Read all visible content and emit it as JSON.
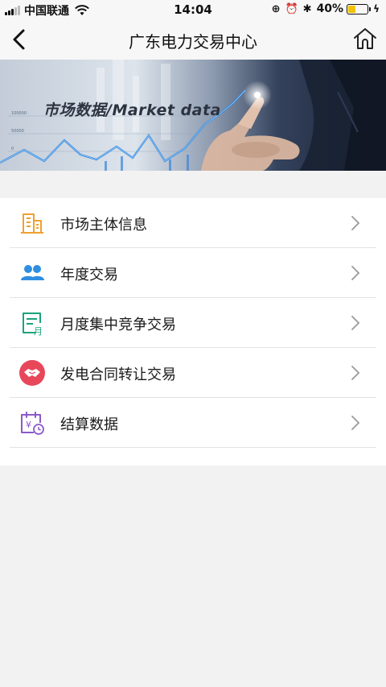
{
  "status_bar": {
    "carrier": "中国联通",
    "time": "14:04",
    "battery": "40%",
    "battery_level": 0.4
  },
  "nav": {
    "title": "广东电力交易中心",
    "back_icon": "chevron-left-icon",
    "home_icon": "home-icon"
  },
  "banner": {
    "text": "市场数据/Market data"
  },
  "menu": {
    "items": [
      {
        "label": "市场主体信息",
        "icon": "building-icon",
        "color": "#f0a030"
      },
      {
        "label": "年度交易",
        "icon": "users-icon",
        "color": "#2e8ee0"
      },
      {
        "label": "月度集中竞争交易",
        "icon": "calendar-month-icon",
        "color": "#1aa37a"
      },
      {
        "label": "发电合同转让交易",
        "icon": "handshake-icon",
        "color": "#e8475a"
      },
      {
        "label": "结算数据",
        "icon": "settlement-calendar-icon",
        "color": "#8a5ac8"
      }
    ]
  }
}
